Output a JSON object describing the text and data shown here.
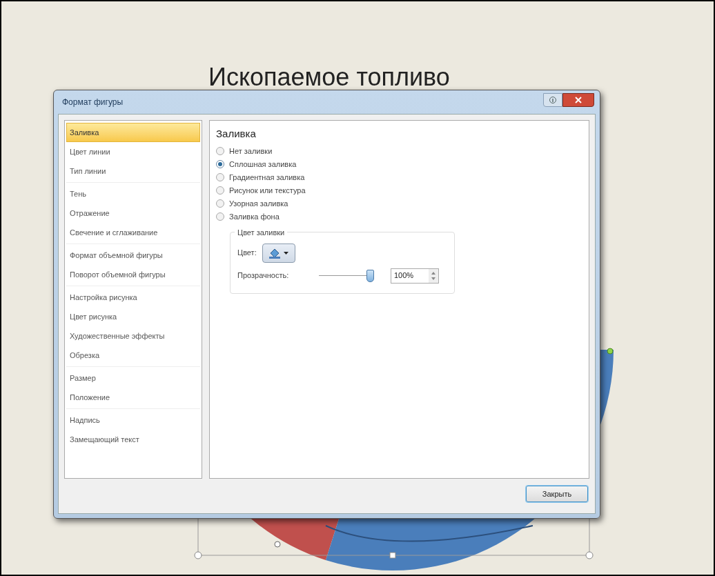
{
  "slide": {
    "title": "Ископаемое топливо"
  },
  "dialog": {
    "title": "Формат фигуры",
    "category_groups": [
      {
        "items": [
          {
            "label": "Заливка",
            "selected": true
          },
          {
            "label": "Цвет линии",
            "selected": false
          },
          {
            "label": "Тип линии",
            "selected": false
          }
        ]
      },
      {
        "items": [
          {
            "label": "Тень",
            "selected": false
          },
          {
            "label": "Отражение",
            "selected": false
          },
          {
            "label": "Свечение и сглаживание",
            "selected": false
          }
        ]
      },
      {
        "items": [
          {
            "label": "Формат объемной фигуры",
            "selected": false
          },
          {
            "label": "Поворот объемной фигуры",
            "selected": false
          }
        ]
      },
      {
        "items": [
          {
            "label": "Настройка рисунка",
            "selected": false
          },
          {
            "label": "Цвет рисунка",
            "selected": false
          },
          {
            "label": "Художественные эффекты",
            "selected": false
          },
          {
            "label": "Обрезка",
            "selected": false
          }
        ]
      },
      {
        "items": [
          {
            "label": "Размер",
            "selected": false
          },
          {
            "label": "Положение",
            "selected": false
          }
        ]
      },
      {
        "items": [
          {
            "label": "Надпись",
            "selected": false
          },
          {
            "label": "Замещающий текст",
            "selected": false
          }
        ]
      }
    ],
    "panel": {
      "heading": "Заливка",
      "fill_options": [
        {
          "label": "Нет заливки",
          "selected": false
        },
        {
          "label": "Сплошная заливка",
          "selected": true
        },
        {
          "label": "Градиентная заливка",
          "selected": false
        },
        {
          "label": "Рисунок или текстура",
          "selected": false
        },
        {
          "label": "Узорная заливка",
          "selected": false
        },
        {
          "label": "Заливка фона",
          "selected": false
        }
      ],
      "fill_color": {
        "legend": "Цвет заливки",
        "color_label": "Цвет:",
        "transparency_label": "Прозрачность:",
        "transparency": {
          "level": 1
        },
        "transparency_value": "100%"
      }
    },
    "buttons": [
      "Закрыть"
    ]
  }
}
